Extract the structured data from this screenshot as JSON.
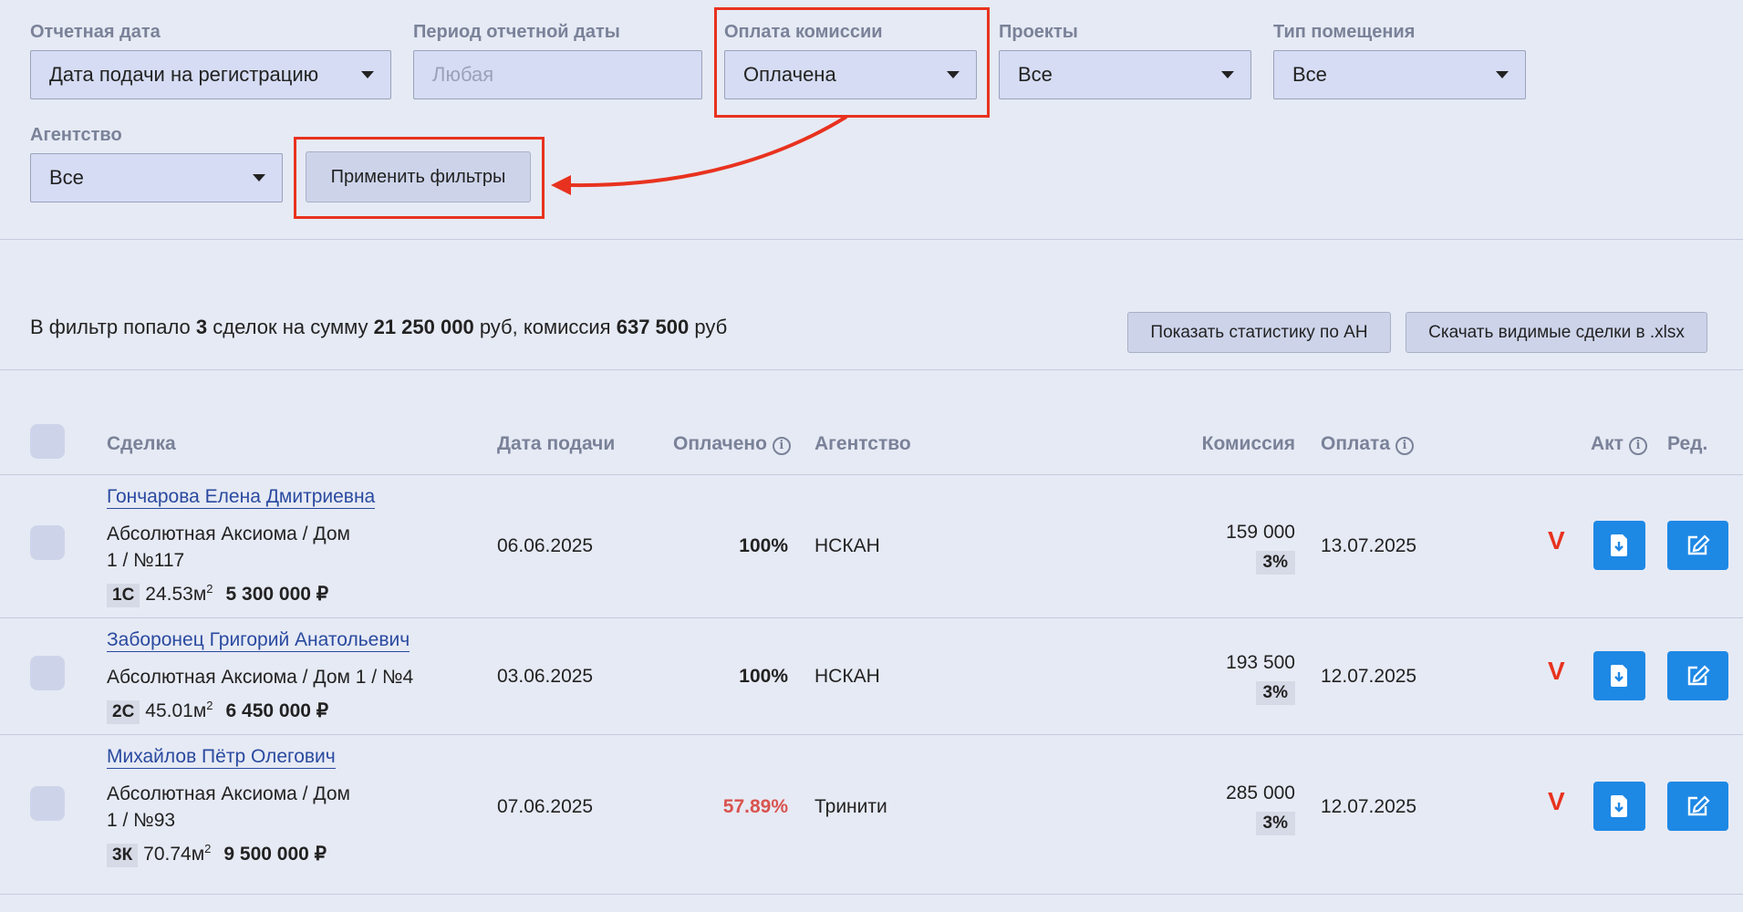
{
  "filters": {
    "report_date": {
      "label": "Отчетная дата",
      "value": "Дата подачи на регистрацию"
    },
    "period": {
      "label": "Период отчетной даты",
      "placeholder": "Любая"
    },
    "commission_payment": {
      "label": "Оплата комиссии",
      "value": "Оплачена"
    },
    "projects": {
      "label": "Проекты",
      "value": "Все"
    },
    "room_type": {
      "label": "Тип помещения",
      "value": "Все"
    },
    "agency": {
      "label": "Агентство",
      "value": "Все"
    },
    "apply_label": "Применить фильтры"
  },
  "summary": {
    "prefix": "В фильтр попало",
    "count": "3",
    "mid1": "сделок на сумму",
    "sum": "21 250 000",
    "mid2": "руб, комиссия",
    "commission": "637 500",
    "suffix": "руб"
  },
  "actions": {
    "stats_label": "Показать статистику по АН",
    "download_label": "Скачать видимые сделки в .xlsx"
  },
  "table": {
    "headers": {
      "deal": "Сделка",
      "date": "Дата подачи",
      "paid": "Оплачено",
      "agency": "Агентство",
      "commission": "Комиссия",
      "payment": "Оплата",
      "act": "Акт",
      "edit": "Ред."
    },
    "rows": [
      {
        "name": "Гончарова Елена Дмитриевна",
        "address_line1": "Абсолютная Аксиома  / Дом",
        "address_line2": "1 / №117",
        "tag": "1С",
        "area": "24.53м",
        "area_sup": "2",
        "price": "5 300 000 ₽",
        "date": "06.06.2025",
        "paid": "100%",
        "agency": "НСКАН",
        "commission": "159 000",
        "commission_pct": "3%",
        "payment_date": "13.07.2025",
        "act_mark": "V"
      },
      {
        "name": "Заборонец Григорий Анатольевич",
        "address_line1": "Абсолютная Аксиома  / Дом 1 / №4",
        "address_line2": "",
        "tag": "2С",
        "area": "45.01м",
        "area_sup": "2",
        "price": "6 450 000 ₽",
        "date": "03.06.2025",
        "paid": "100%",
        "agency": "НСКАН",
        "commission": "193 500",
        "commission_pct": "3%",
        "payment_date": "12.07.2025",
        "act_mark": "V"
      },
      {
        "name": "Михайлов Пётр Олегович",
        "address_line1": "Абсолютная Аксиома  / Дом",
        "address_line2": "1 / №93",
        "tag": "3К",
        "area": "70.74м",
        "area_sup": "2",
        "price": "9 500 000 ₽",
        "date": "07.06.2025",
        "paid": "57.89%",
        "agency": "Тринити",
        "commission": "285 000",
        "commission_pct": "3%",
        "payment_date": "12.07.2025",
        "act_mark": "V"
      }
    ]
  },
  "colors": {
    "background": "#e6eaf4",
    "annotation_red": "#e8321f",
    "link_blue": "#2a4aa0",
    "action_blue": "#1e88e5",
    "partial_paid_red": "#d9534f"
  }
}
